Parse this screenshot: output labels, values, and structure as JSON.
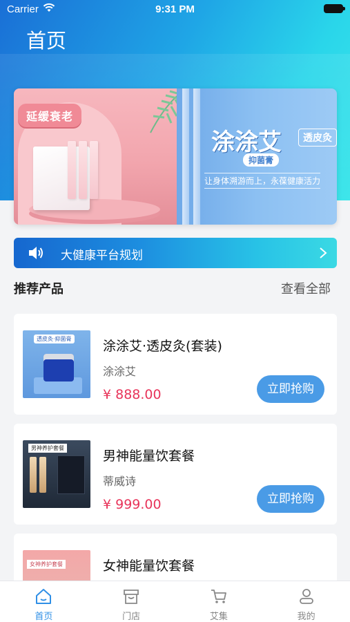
{
  "status_bar": {
    "carrier": "Carrier",
    "time": "9:31 PM"
  },
  "header": {
    "title": "首页"
  },
  "banner": {
    "tag": "延缓衰老",
    "brand": "涂涂艾",
    "product": "透皮灸",
    "pill": "抑菌膏",
    "slogan": "让身体溯游而上，永葆健康活力"
  },
  "notice": {
    "text": "大健康平台规划"
  },
  "section": {
    "title": "推荐产品",
    "see_all": "查看全部"
  },
  "products": [
    {
      "title": "涂涂艾·透皮灸(套装)",
      "brand": "涂涂艾",
      "price": "¥ 888.00",
      "button": "立即抢购",
      "image_label": "透皮灸·抑菌膏"
    },
    {
      "title": "男神能量饮套餐",
      "brand": "蒂威诗",
      "price": "¥ 999.00",
      "button": "立即抢购",
      "image_label": "男神养护套餐"
    },
    {
      "title": "女神能量饮套餐",
      "image_label": "女神养护套餐"
    }
  ],
  "tabbar": {
    "items": [
      {
        "label": "首页",
        "icon": "home-icon",
        "active": true
      },
      {
        "label": "门店",
        "icon": "store-icon",
        "active": false
      },
      {
        "label": "艾集",
        "icon": "cart-icon",
        "active": false
      },
      {
        "label": "我的",
        "icon": "user-icon",
        "active": false
      }
    ]
  },
  "colors": {
    "accent": "#2f8fe6",
    "price": "#e8345a",
    "button": "#4a9be6"
  }
}
